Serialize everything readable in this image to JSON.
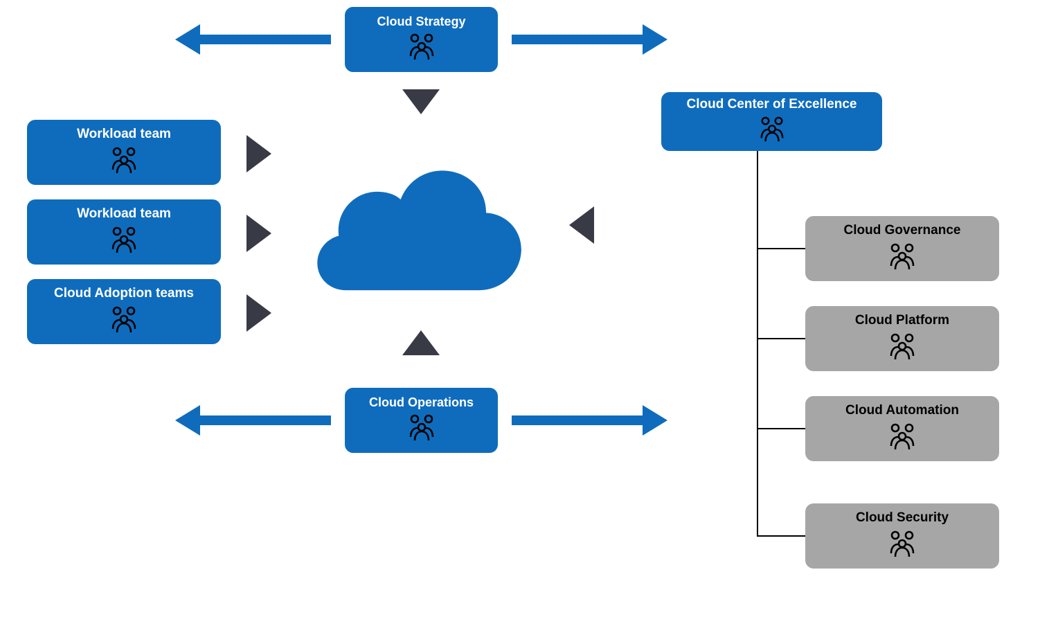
{
  "colors": {
    "blue": "#0f6cbd",
    "gray": "#a7a6a7",
    "dark": "#383a46"
  },
  "nodes": {
    "cloud_strategy": "Cloud Strategy",
    "cloud_operations": "Cloud Operations",
    "workload_team_1": "Workload team",
    "workload_team_2": "Workload team",
    "cloud_adoption": "Cloud Adoption teams",
    "ccoe": "Cloud Center of Excellence",
    "cloud_governance": "Cloud Governance",
    "cloud_platform": "Cloud Platform",
    "cloud_automation": "Cloud Automation",
    "cloud_security": "Cloud Security"
  }
}
